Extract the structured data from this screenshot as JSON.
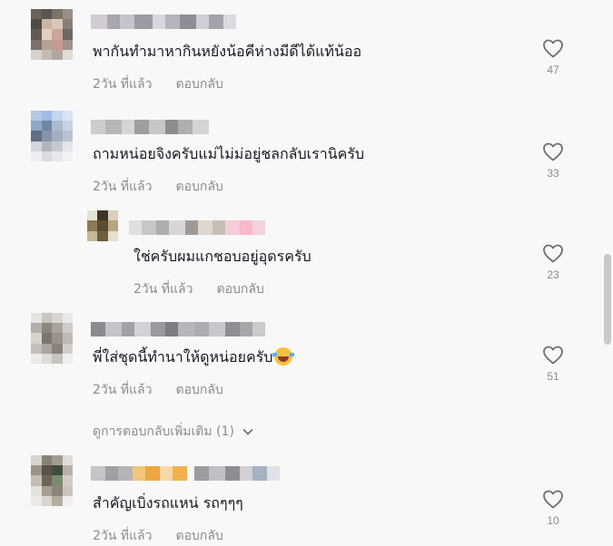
{
  "comments": [
    {
      "text": "พากันทำมาหากินหยังน้อคีห่างมีดีได้แท้น้ออ",
      "time": "2วัน ที่แล้ว",
      "reply": "ตอบกลับ",
      "likes": "47"
    },
    {
      "text": "ถามหน่อยจิงครับแม่ไม่ม่อยู่ชลกลับเรานิครับ",
      "time": "2วัน ที่แล้ว",
      "reply": "ตอบกลับ",
      "likes": "33"
    },
    {
      "text": "ใช่ครับผมแกชอบอยู่อุดรครับ",
      "time": "2วัน ที่แล้ว",
      "reply": "ตอบกลับ",
      "likes": "23"
    },
    {
      "text": "พี่ใส่ชุดนี้ทำนาให้ดูหน่อยครับ",
      "time": "2วัน ที่แล้ว",
      "reply": "ตอบกลับ",
      "likes": "51"
    },
    {
      "text": "สำคัญเบิ่งรถแหน่ รถๆๆๆ",
      "time": "2วัน ที่แล้ว",
      "reply": "ตอบกลับ",
      "likes": "10"
    }
  ],
  "more_replies": "ดูการตอบกลับเพิ่มเติม (1)",
  "icons": {
    "like": "heart-outline-icon",
    "expand": "chevron-down-icon",
    "emoji": "rolling-on-floor-laughing-emoji"
  },
  "colors": {
    "background": "#f8f8f8",
    "text": "#161823",
    "muted": "#8a8b91"
  }
}
